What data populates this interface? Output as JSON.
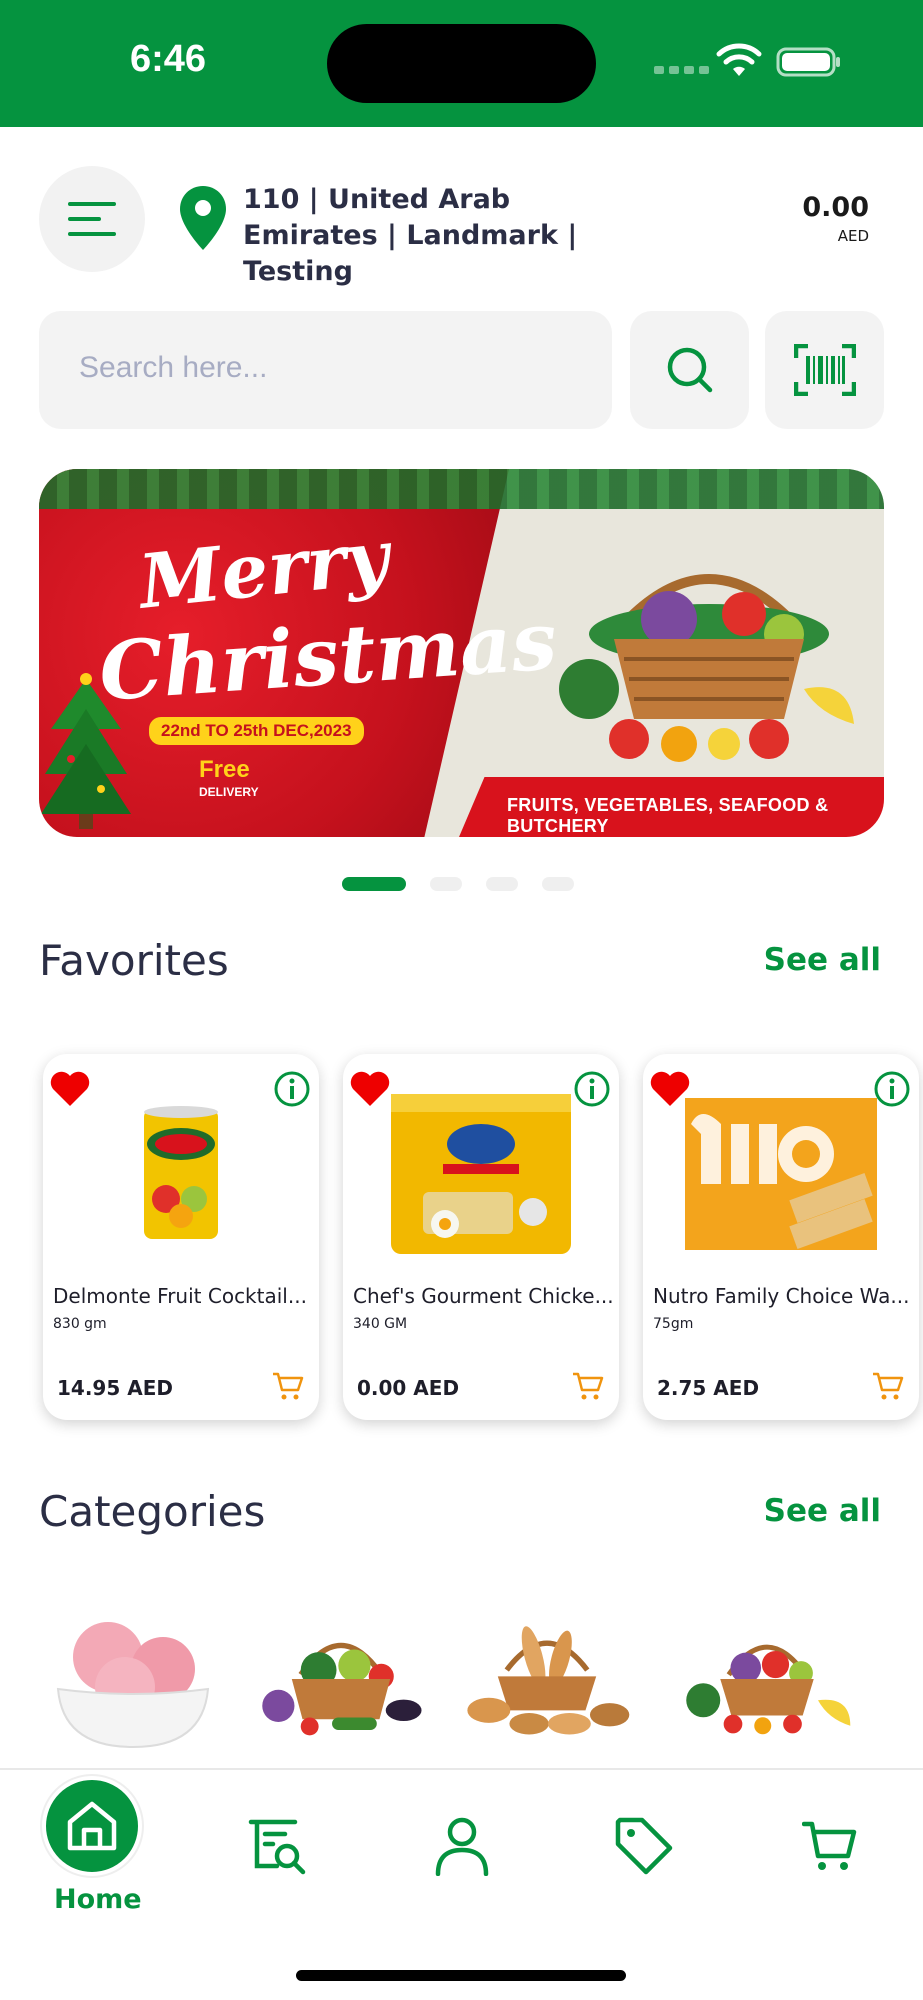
{
  "status_bar": {
    "time": "6:46"
  },
  "header": {
    "address": "110 | United Arab Emirates | Landmark  | Testing",
    "balance_amount": "0.00",
    "balance_currency": "AED"
  },
  "search": {
    "placeholder": "Search here..."
  },
  "banner": {
    "title_line1": "Merry",
    "title_line2": "Christmas",
    "date": "22nd TO 25th DEC,2023",
    "free": "Free",
    "delivery": "DELIVERY",
    "strip_text": "FRUITS, VEGETABLES, SEAFOOD & BUTCHERY",
    "page_count": 4,
    "active_page": 1
  },
  "favorites": {
    "title": "Favorites",
    "see_all": "See all",
    "items": [
      {
        "name": "Delmonte Fruit Cocktail...",
        "size": "830 gm",
        "price": "14.95 AED",
        "favorited": true
      },
      {
        "name": "Chef's Gourment Chicke...",
        "size": "340 GM",
        "price": "0.00 AED",
        "favorited": true
      },
      {
        "name": "Nutro Family Choice Wa...",
        "size": "75gm",
        "price": "2.75 AED",
        "favorited": true
      }
    ]
  },
  "categories": {
    "title": "Categories",
    "see_all": "See all",
    "items": [
      {
        "icon": "ice-cream-image"
      },
      {
        "icon": "vegetable-basket-image"
      },
      {
        "icon": "bread-basket-image"
      },
      {
        "icon": "fruit-basket-image"
      }
    ]
  },
  "bottom_nav": {
    "home_label": "Home",
    "items": [
      "home-icon",
      "search-list-icon",
      "profile-icon",
      "offers-tag-icon",
      "cart-icon"
    ]
  },
  "colors": {
    "brand_green": "#05933f",
    "heart_red": "#ee0000",
    "cart_orange": "#f0940e",
    "text_dark": "#2b2e45"
  }
}
